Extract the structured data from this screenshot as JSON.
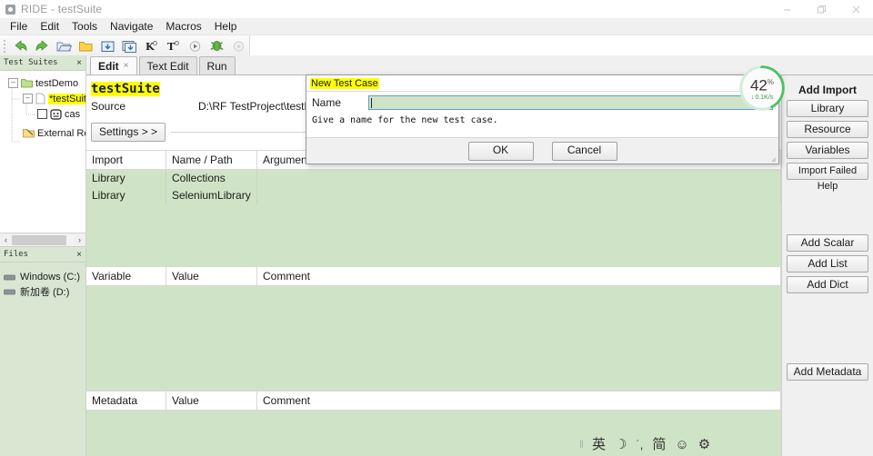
{
  "window": {
    "title": "RIDE - testSuite",
    "icon": "app-icon",
    "controls": {
      "minimize": "minimize-icon",
      "maximize": "restore-icon",
      "close": "close-icon"
    }
  },
  "menubar": {
    "items": [
      "File",
      "Edit",
      "Tools",
      "Navigate",
      "Macros",
      "Help"
    ]
  },
  "toolbar": {
    "items": [
      {
        "name": "back-arrow-icon",
        "tip": "Back"
      },
      {
        "name": "forward-arrow-icon",
        "tip": "Forward"
      },
      {
        "name": "open-folder-icon",
        "tip": "Open"
      },
      {
        "name": "new-folder-icon",
        "tip": "New"
      },
      {
        "name": "save-icon",
        "tip": "Save"
      },
      {
        "name": "save-all-icon",
        "tip": "Save All"
      },
      {
        "name": "keyword-search-icon",
        "tip": "Search Keywords"
      },
      {
        "name": "test-search-icon",
        "tip": "Search Tests"
      },
      {
        "name": "run-icon",
        "tip": "Run"
      },
      {
        "name": "debug-icon",
        "tip": "Debug"
      },
      {
        "name": "stop-icon",
        "tip": "Stop"
      }
    ]
  },
  "left_dock": {
    "test_suites": {
      "header": "Test Suites",
      "close": "×",
      "tree": [
        {
          "label": "testDemo",
          "icon": "folder-icon",
          "expander": "-",
          "level": 1,
          "highlight": false,
          "checkbox": false
        },
        {
          "label": "*testSuite",
          "icon": "file-icon",
          "expander": "-",
          "level": 2,
          "highlight": true,
          "checkbox": false
        },
        {
          "label": "cas",
          "icon": "testcase-icon",
          "expander": "",
          "level": 3,
          "highlight": false,
          "checkbox": true
        },
        {
          "label": "External Re",
          "icon": "resource-icon",
          "expander": "",
          "level": 2,
          "highlight": false,
          "checkbox": false
        }
      ],
      "scroll_left": "‹",
      "scroll_right": "›"
    },
    "files": {
      "header": "Files",
      "close": "×",
      "drives": [
        "Windows (C:)",
        "新加卷 (D:)"
      ]
    }
  },
  "editor": {
    "tabs": [
      {
        "label": "Edit",
        "active": true,
        "closable": true,
        "close": "×"
      },
      {
        "label": "Text Edit",
        "active": false,
        "closable": false
      },
      {
        "label": "Run",
        "active": false,
        "closable": false
      }
    ],
    "suite_name": "testSuite",
    "source_label": "Source",
    "source_value": "D:\\RF TestProject\\testDemo",
    "settings_button": "Settings > >",
    "import_grid": {
      "headers": [
        "Import",
        "Name / Path",
        "Arguments"
      ],
      "rows": [
        [
          "Library",
          "Collections",
          ""
        ],
        [
          "Library",
          "SeleniumLibrary",
          ""
        ]
      ]
    },
    "variable_grid": {
      "headers": [
        "Variable",
        "Value",
        "Comment"
      ],
      "rows": []
    },
    "metadata_grid": {
      "headers": [
        "Metadata",
        "Value",
        "Comment"
      ],
      "rows": []
    },
    "side_panel": {
      "add_import_title": "Add Import",
      "import_buttons": [
        "Library",
        "Resource",
        "Variables",
        "Import Failed Help"
      ],
      "variable_buttons": [
        "Add Scalar",
        "Add List",
        "Add Dict"
      ],
      "metadata_buttons": [
        "Add Metadata"
      ]
    }
  },
  "dialog": {
    "title": "New Test Case",
    "field_label": "Name",
    "field_value": "",
    "field_placeholder": "",
    "hint": "Give a name for the new test case.",
    "ok_label": "OK",
    "cancel_label": "Cancel",
    "resize_grip": "resize-grip-icon"
  },
  "speed_widget": {
    "percent": "42",
    "percent_symbol": "%",
    "rate": "0.1K/s",
    "arrow": "↓",
    "ring_color": "#4cc764",
    "progress": 42
  },
  "ime_bar": {
    "handle": "‖",
    "items": [
      {
        "name": "language-mode-icon",
        "glyph": "英"
      },
      {
        "name": "moon-icon",
        "glyph": "☽"
      },
      {
        "name": "punctuation-icon",
        "glyph": "˙,"
      },
      {
        "name": "simplified-chinese-icon",
        "glyph": "简"
      },
      {
        "name": "emoji-icon",
        "glyph": "☺"
      },
      {
        "name": "settings-icon",
        "glyph": "⚙"
      }
    ]
  },
  "colors": {
    "grid_row_green": "#cfe3c6",
    "pane_header_green": "#d9e7d2",
    "highlight_yellow": "#ffff00",
    "accent_green": "#4cc764"
  }
}
